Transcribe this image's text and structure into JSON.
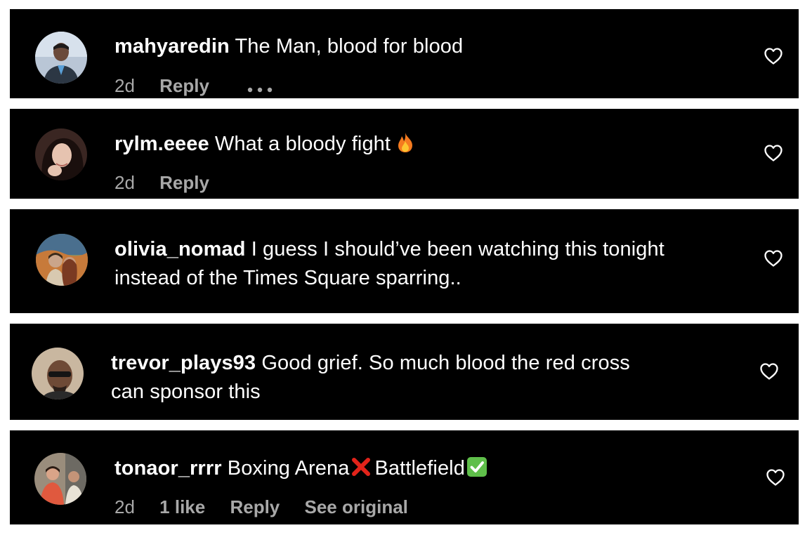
{
  "comments": [
    {
      "username": "mahyaredin",
      "text": "The Man, blood for blood",
      "time": "2d",
      "reply_label": "Reply",
      "more_icon": "more-dots-icon",
      "like_icon": "heart-outline-icon"
    },
    {
      "username": "rylm.eeee",
      "text": "What a bloody fight",
      "emoji_icon": "fire-emoji-icon",
      "time": "2d",
      "reply_label": "Reply",
      "like_icon": "heart-outline-icon"
    },
    {
      "username": "olivia_nomad",
      "text_line1": "I guess I should’ve been watching this tonight",
      "text_line2": "instead of the Times Square sparring..",
      "like_icon": "heart-outline-icon"
    },
    {
      "username": "trevor_plays93",
      "text_line1": "Good grief. So much blood the red cross",
      "text_line2": "can sponsor this",
      "like_icon": "heart-outline-icon"
    },
    {
      "username": "tonaor_rrrr",
      "text_part1": "Boxing Arena",
      "cross_icon": "red-x-emoji-icon",
      "text_part2": "Battlefield",
      "check_icon": "green-check-emoji-icon",
      "time": "2d",
      "likes_label": "1 like",
      "reply_label": "Reply",
      "see_original_label": "See original",
      "like_icon": "heart-outline-icon"
    }
  ],
  "colors": {
    "card_background": "#000000",
    "text_primary": "#ffffff",
    "text_secondary": "#a8a8a8",
    "divider": "#ffffff"
  }
}
